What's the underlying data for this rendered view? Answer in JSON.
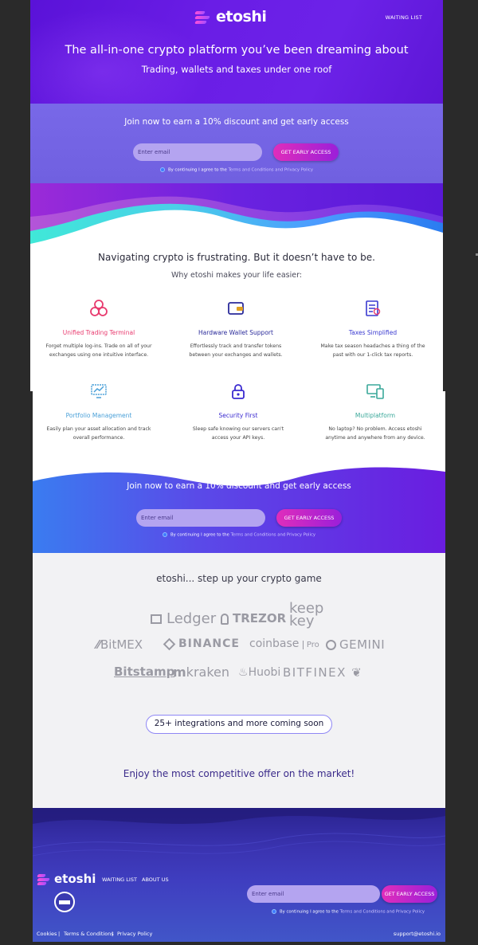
{
  "header": {
    "brand": "etoshi",
    "nav_waiting": "WAITING LIST",
    "headline": "The all-in-one crypto platform you’ve been dreaming about",
    "subheadline": "Trading, wallets and taxes under one roof"
  },
  "signup": {
    "title": "Join now to earn a 10% discount and get early access",
    "email_placeholder": "Enter email",
    "cta_label": "GET EARLY ACCESS",
    "agree_prefix": "By continuing I agree to the",
    "agree_links": "Terms and Conditions and Privacy Policy"
  },
  "features": {
    "title": "Navigating crypto is frustrating. But it doesn’t have to be.",
    "subtitle": "Why etoshi makes your life easier:",
    "items": [
      {
        "title": "Unified Trading Terminal",
        "desc_1": "Forget multiple log-ins. Trade on all of your",
        "desc_2": "exchanges using one intuitive interface.",
        "color": "#e83a6e",
        "icon": "circles-icon"
      },
      {
        "title": "Hardware Wallet Support",
        "desc_1": "Effortlessly track and transfer tokens",
        "desc_2": "between your exchanges and wallets.",
        "color": "#2a2a9a",
        "icon": "wallet-icon"
      },
      {
        "title": "Taxes Simplified",
        "desc_1": "Make tax season headaches a thing of the",
        "desc_2": "past with our 1-click tax reports.",
        "color": "#3a3ad0",
        "icon": "report-icon"
      },
      {
        "title": "Portfolio Management",
        "desc_1": "Easily plan your asset allocation and track",
        "desc_2": "overall performance.",
        "color": "#4aa0d8",
        "icon": "portfolio-icon"
      },
      {
        "title": "Security First",
        "desc_1": "Sleep safe knowing our servers can't",
        "desc_2": "access your API keys.",
        "color": "#3a2ad0",
        "icon": "lock-icon"
      },
      {
        "title": "Multiplatform",
        "desc_1": "No laptop? No problem. Access etoshi",
        "desc_2": "anytime and anywhere from any device.",
        "color": "#3aa89a",
        "icon": "devices-icon"
      }
    ]
  },
  "partners": {
    "title": "etoshi... step up your crypto game",
    "brands": [
      "Ledger",
      "TREZOR",
      "keep",
      "key",
      "BitMEX",
      "BINANCE",
      "coinbase",
      "Pro",
      "GEMINI",
      "Bitstamp",
      "kraken",
      "Huobi",
      "BITFINEX"
    ],
    "pill": "25+ integrations and more coming soon",
    "offer": "Enjoy the most competitive offer on the market!"
  },
  "footer": {
    "nav_waiting": "WAITING LIST",
    "nav_about": "ABOUT US",
    "cookies": "Cookies",
    "terms": "Terms & Conditions",
    "privacy": "Privacy Policy",
    "sep": "|",
    "email": "support@etoshi.io"
  },
  "colors": {
    "hero": "#6a1de6",
    "signup": "#7466e6",
    "cta_start": "#e02dbb",
    "cta_end": "#9b1fd9",
    "teal": "#3ee6d6",
    "footer": "#3a33b0"
  }
}
